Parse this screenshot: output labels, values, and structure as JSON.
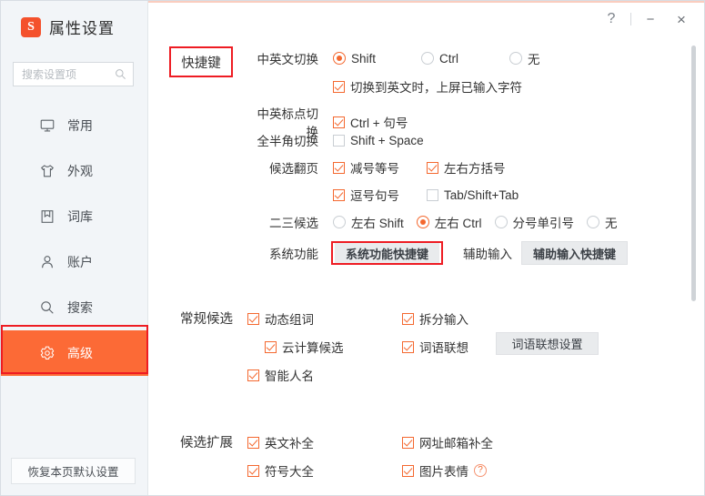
{
  "window": {
    "title": "属性设置",
    "logo_text": "S",
    "controls": {
      "help": "?",
      "minimize": "−",
      "close": "×"
    }
  },
  "sidebar": {
    "search": {
      "placeholder": "搜索设置项",
      "value": ""
    },
    "items": [
      {
        "label": "常用",
        "icon": "monitor-icon",
        "active": false
      },
      {
        "label": "外观",
        "icon": "shirt-icon",
        "active": false
      },
      {
        "label": "词库",
        "icon": "book-icon",
        "active": false
      },
      {
        "label": "账户",
        "icon": "user-icon",
        "active": false
      },
      {
        "label": "搜索",
        "icon": "search-icon",
        "active": false
      },
      {
        "label": "高级",
        "icon": "gear-icon",
        "active": true
      }
    ],
    "reset_label": "恢复本页默认设置"
  },
  "content": {
    "groups": {
      "hotkey": {
        "title": "快捷键",
        "rows": {
          "cn_en_switch": {
            "label": "中英文切换",
            "options": [
              {
                "label": "Shift",
                "selected": true
              },
              {
                "label": "Ctrl",
                "selected": false
              },
              {
                "label": "无",
                "selected": false
              }
            ],
            "sub_checkbox": {
              "label": "切换到英文时，上屏已输入字符",
              "checked": true
            }
          },
          "punct_switch": {
            "label": "中英标点切换",
            "checkbox": {
              "label": "Ctrl + 句号",
              "checked": true
            }
          },
          "width_switch": {
            "label": "全半角切换",
            "checkbox": {
              "label": "Shift + Space",
              "checked": false
            }
          },
          "page_turn": {
            "label": "候选翻页",
            "items": [
              {
                "label": "减号等号",
                "checked": true
              },
              {
                "label": "左右方括号",
                "checked": true
              },
              {
                "label": "逗号句号",
                "checked": true
              },
              {
                "label": "Tab/Shift+Tab",
                "checked": false
              }
            ]
          },
          "second_third": {
            "label": "二三候选",
            "options": [
              {
                "label": "左右 Shift",
                "selected": false
              },
              {
                "label": "左右 Ctrl",
                "selected": true
              },
              {
                "label": "分号单引号",
                "selected": false
              },
              {
                "label": "无",
                "selected": false
              }
            ]
          },
          "system_func": {
            "label": "系统功能",
            "button": "系统功能快捷键",
            "label2": "辅助输入",
            "button2": "辅助输入快捷键"
          }
        }
      },
      "normal_candidate": {
        "title": "常规候选",
        "items": [
          {
            "label": "动态组词",
            "checked": true
          },
          {
            "label": "云计算候选",
            "checked": true
          },
          {
            "label": "智能人名",
            "checked": true
          },
          {
            "label": "拆分输入",
            "checked": true
          },
          {
            "label": "词语联想",
            "checked": true
          }
        ],
        "assoc_button": "词语联想设置"
      },
      "candidate_extend": {
        "title": "候选扩展",
        "items": [
          {
            "label": "英文补全",
            "checked": true
          },
          {
            "label": "符号大全",
            "checked": true
          },
          {
            "label": "网址邮箱补全",
            "checked": true
          },
          {
            "label": "图片表情",
            "checked": true,
            "help": "?"
          }
        ]
      }
    }
  },
  "colors": {
    "accent": "#f4682f",
    "sidebar_active": "#fc6a36",
    "annotation": "#ee1c23"
  }
}
